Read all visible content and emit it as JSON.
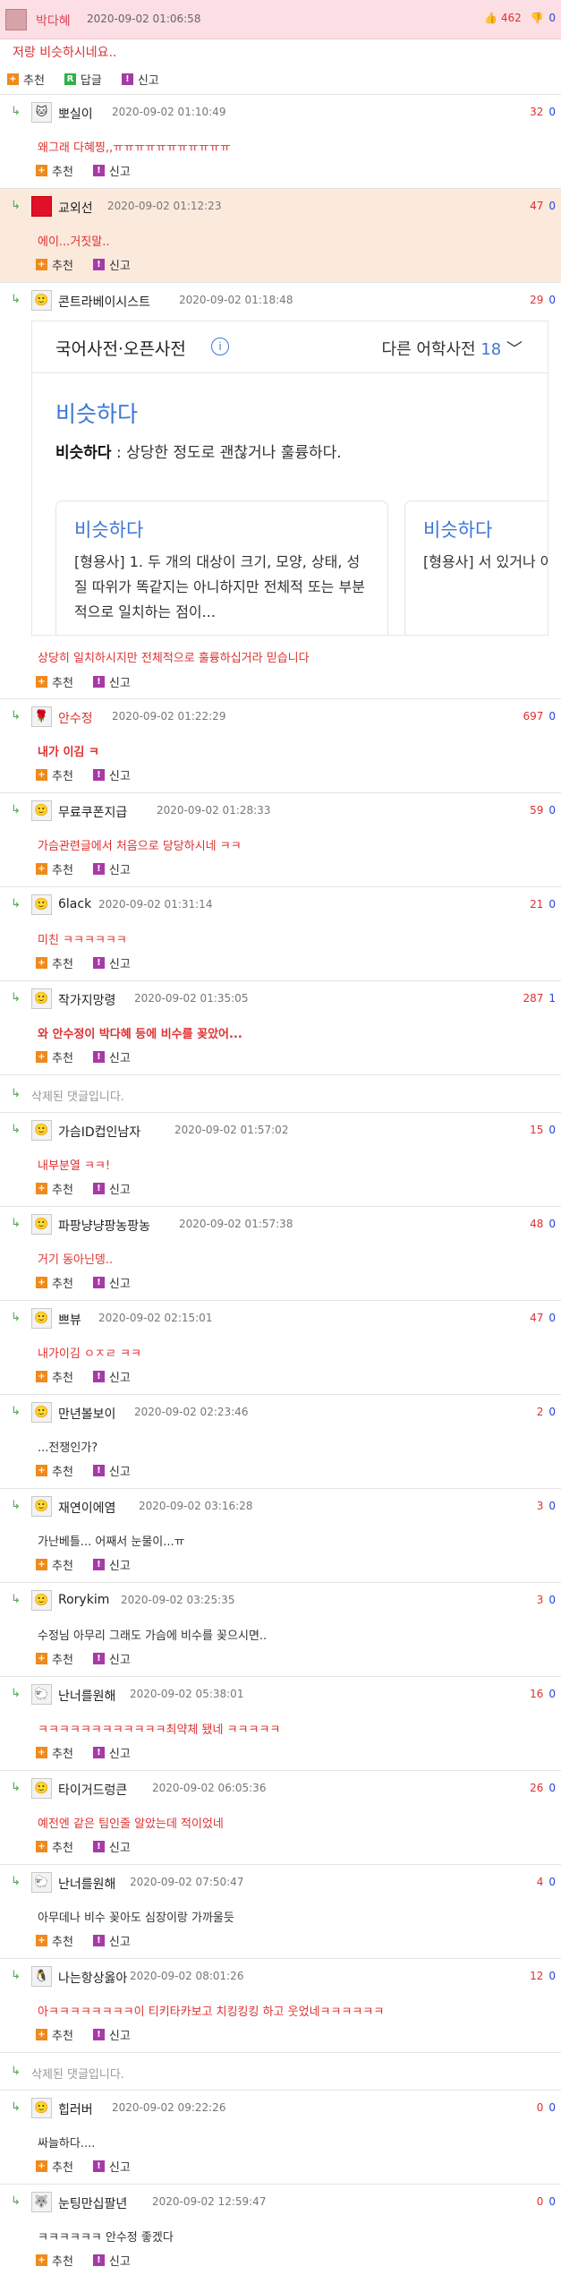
{
  "post": {
    "nick": "박다혜",
    "date": "2020-09-02 01:06:58",
    "up": "462",
    "down": "0",
    "text": "저랑 비슷하시네요..",
    "actions": [
      "추천",
      "답글",
      "신고"
    ]
  },
  "action_labels": {
    "recommend": "추천",
    "report": "신고"
  },
  "dictionary": {
    "title": "국어사전·오픈사전",
    "other_label": "다른 어학사전",
    "other_count": "18",
    "word": "비슷하다",
    "definition_word": "비슷하다",
    "definition_text": " : 상당한 정도로 괜찮거나 훌륭하다.",
    "cards": [
      {
        "word": "비슷하다",
        "def": "[형용사] 1. 두 개의 대상이 크기, 모양, 상태, 성질 따위가 똑같지는 아니하지만 전체적 또는 부분적으로 일치하는 점이..."
      },
      {
        "word": "비슷하다",
        "def": "[형용사] 서 있거나 아니하고 한쪽으로..."
      }
    ]
  },
  "deleted_text": "삭제된 댓글입니다.",
  "comments": [
    {
      "nick": "뽀실이",
      "date": "2020-09-02 01:10:49",
      "up": "32",
      "down": "0",
      "text": "왜그래 다혜찡,,ㅠㅠㅠㅠㅠㅠㅠㅠㅠㅠㅠ",
      "tone": "red",
      "avatar": "🐱"
    },
    {
      "nick": "교외선",
      "date": "2020-09-02 01:12:23",
      "up": "47",
      "down": "0",
      "text": "에이...거짓말..",
      "tone": "red",
      "avatar": "",
      "highlight": true
    },
    {
      "nick": "콘트라베이시스트",
      "date": "2020-09-02 01:18:48",
      "up": "29",
      "down": "0",
      "text": "상당히 일치하시지만 전체적으로 훌륭하십거라 믿습니다",
      "tone": "red",
      "avatar": "🙂"
    },
    {
      "nick": "안수정",
      "date": "2020-09-02 01:22:29",
      "up": "697",
      "down": "0",
      "text": "내가 이김 ㅋ",
      "tone": "red",
      "avatar": "🌹",
      "nick_red": true
    },
    {
      "nick": "무료쿠폰지급",
      "date": "2020-09-02 01:28:33",
      "up": "59",
      "down": "0",
      "text": "가슴관련글에서 처음으로 당당하시네 ㅋㅋ",
      "tone": "red",
      "avatar": "🙂"
    },
    {
      "nick": "6lack",
      "date": "2020-09-02 01:31:14",
      "up": "21",
      "down": "0",
      "text": "미친 ㅋㅋㅋㅋㅋㅋ",
      "tone": "red",
      "avatar": "🙂"
    },
    {
      "nick": "작가지망령",
      "date": "2020-09-02 01:35:05",
      "up": "287",
      "down": "1",
      "text": "와 안수정이 박다혜 등에 비수를 꽂았어...",
      "tone": "red",
      "avatar": "🙂"
    },
    {
      "nick": "가슴ID컵인남자",
      "date": "2020-09-02 01:57:02",
      "up": "15",
      "down": "0",
      "text": "내부분열 ㅋㅋ!",
      "tone": "red",
      "avatar": "🙂"
    },
    {
      "nick": "파팡냥냥팡농팡농",
      "date": "2020-09-02 01:57:38",
      "up": "48",
      "down": "0",
      "text": "거기 동아닌뎅..",
      "tone": "red",
      "avatar": "🙂"
    },
    {
      "nick": "쁘뷰",
      "date": "2020-09-02 02:15:01",
      "up": "47",
      "down": "0",
      "text": "내가이김 ㅇㅈㄹ ㅋㅋ",
      "tone": "red",
      "avatar": "🙂"
    },
    {
      "nick": "만년볼보이",
      "date": "2020-09-02 02:23:46",
      "up": "2",
      "down": "0",
      "text": "...전쟁인가?",
      "tone": "dark",
      "avatar": "🙂"
    },
    {
      "nick": "재연이에염",
      "date": "2020-09-02 03:16:28",
      "up": "3",
      "down": "0",
      "text": "가난베틀... 어째서 눈물이...ㅠ",
      "tone": "dark",
      "avatar": "🙂"
    },
    {
      "nick": "Rorykim",
      "date": "2020-09-02 03:25:35",
      "up": "3",
      "down": "0",
      "text": "수정님 아무리 그래도 가슴에 비수를 꽂으시면..",
      "tone": "dark",
      "avatar": "🙂"
    },
    {
      "nick": "난너를원해",
      "date": "2020-09-02 05:38:01",
      "up": "16",
      "down": "0",
      "text": "ㅋㅋㅋㅋㅋㅋㅋㅋㅋㅋㅋㅋ최약체 됐네 ㅋㅋㅋㅋㅋ",
      "tone": "red",
      "avatar": "🐑"
    },
    {
      "nick": "타이거드렁큰",
      "date": "2020-09-02 06:05:36",
      "up": "26",
      "down": "0",
      "text": "예전엔 같은 팀인줄 알았는데 적이었네",
      "tone": "red",
      "avatar": "🙂"
    },
    {
      "nick": "난너를원해",
      "date": "2020-09-02 07:50:47",
      "up": "4",
      "down": "0",
      "text": "아무데나 비수 꽂아도 심장이랑 가까울듯",
      "tone": "dark",
      "avatar": "🐑"
    },
    {
      "nick": "나는항상옳아",
      "date": "2020-09-02 08:01:26",
      "up": "12",
      "down": "0",
      "text": "아ㅋㅋㅋㅋㅋㅋㅋㅋ이 티키타카보고 치킹킹킹 하고 웃었네ㅋㅋㅋㅋㅋㅋ",
      "tone": "red",
      "avatar": "🐧"
    },
    {
      "nick": "힙러버",
      "date": "2020-09-02 09:22:26",
      "up": "0",
      "down": "0",
      "text": "싸늘하다....",
      "tone": "dark",
      "avatar": "🙂"
    },
    {
      "nick": "눈팅만십팔년",
      "date": "2020-09-02 12:59:47",
      "up": "0",
      "down": "0",
      "text": "ㅋㅋㅋㅋㅋㅋ 안수정 좋겠다",
      "tone": "dark",
      "avatar": "🐺"
    }
  ]
}
